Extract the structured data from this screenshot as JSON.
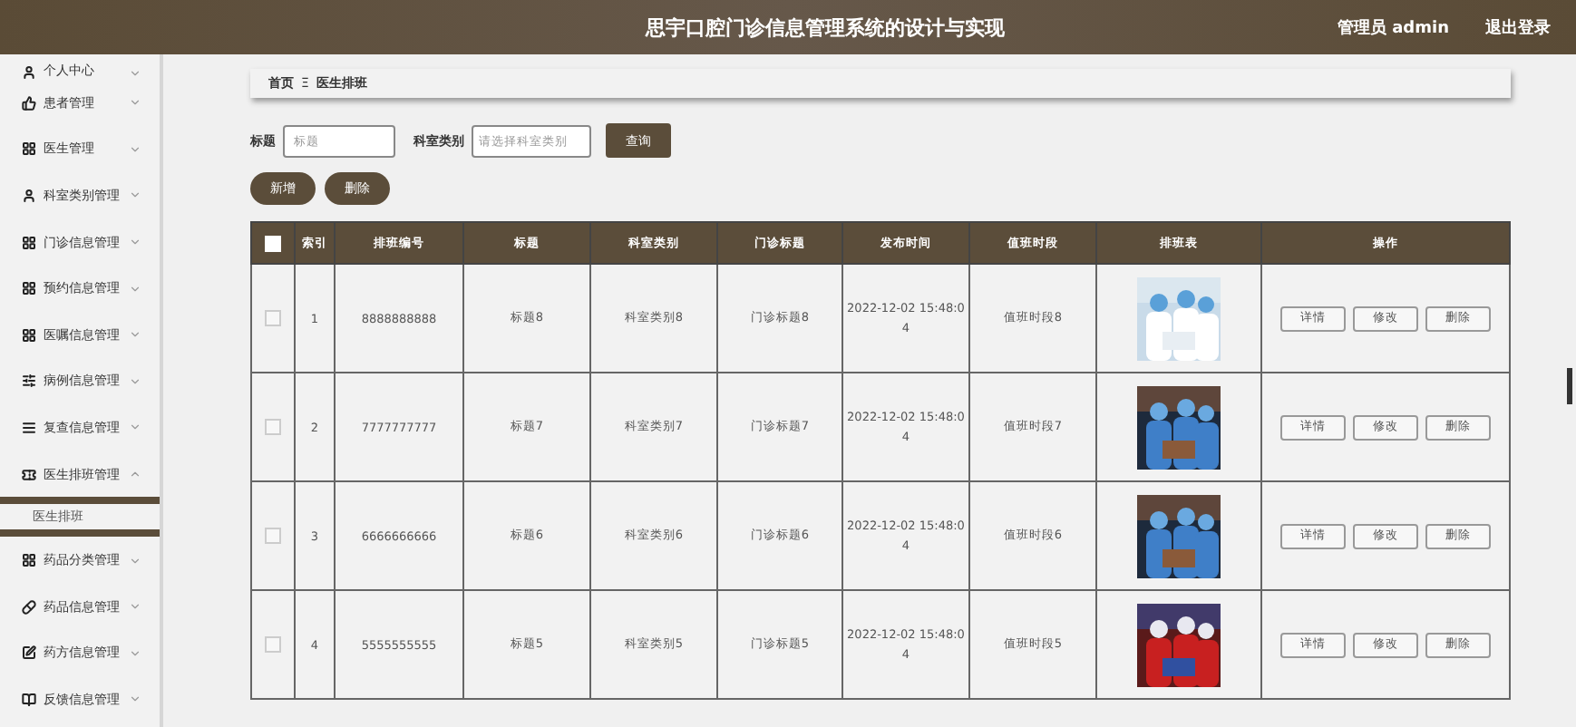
{
  "header": {
    "title": "思宇口腔门诊信息管理系统的设计与实现",
    "user": "管理员 admin",
    "logout": "退出登录"
  },
  "sidebar": {
    "items": [
      {
        "label": "个人中心",
        "expanded": false
      },
      {
        "label": "患者管理",
        "expanded": false
      },
      {
        "label": "医生管理",
        "expanded": false
      },
      {
        "label": "科室类别管理",
        "expanded": false
      },
      {
        "label": "门诊信息管理",
        "expanded": false
      },
      {
        "label": "预约信息管理",
        "expanded": false
      },
      {
        "label": "医嘱信息管理",
        "expanded": false
      },
      {
        "label": "病例信息管理",
        "expanded": false
      },
      {
        "label": "复查信息管理",
        "expanded": false
      },
      {
        "label": "医生排班管理",
        "expanded": true,
        "children": [
          {
            "label": "医生排班",
            "selected": true
          }
        ]
      },
      {
        "label": "药品分类管理",
        "expanded": false
      },
      {
        "label": "药品信息管理",
        "expanded": false
      },
      {
        "label": "药方信息管理",
        "expanded": false
      },
      {
        "label": "反馈信息管理",
        "expanded": false
      }
    ]
  },
  "breadcrumb": {
    "home": "首页",
    "separator": "Ξ",
    "current": "医生排班"
  },
  "search": {
    "title_label": "标题",
    "title_placeholder": "标题",
    "category_label": "科室类别",
    "category_placeholder": "请选择科室类别",
    "button": "查询"
  },
  "actions": [
    "新增",
    "删除"
  ],
  "table": {
    "header_checked": false,
    "columns": [
      "索引",
      "排班编号",
      "标题",
      "科室类别",
      "门诊标题",
      "发布时间",
      "值班时段",
      "排班表",
      "操作"
    ],
    "rows": [
      {
        "checked": false,
        "index": "1",
        "code": "8888888888",
        "title": "标题8",
        "category": "科室类别8",
        "clinic": "门诊标题8",
        "time": "2022-12-02 15:48:04",
        "shift": "值班时段8",
        "schedule": {
          "kind": "picture"
        },
        "buttons": [
          "详情",
          "修改",
          "删除"
        ]
      },
      {
        "checked": false,
        "index": "2",
        "code": "7777777777",
        "title": "标题7",
        "category": "科室类别7",
        "clinic": "门诊标题7",
        "time": "2022-12-02 15:48:04",
        "shift": "值班时段7",
        "schedule": {
          "kind": "picture"
        },
        "buttons": [
          "详情",
          "修改",
          "删除"
        ]
      },
      {
        "checked": false,
        "index": "3",
        "code": "6666666666",
        "title": "标题6",
        "category": "科室类别6",
        "clinic": "门诊标题6",
        "time": "2022-12-02 15:48:04",
        "shift": "值班时段6",
        "schedule": {
          "kind": "picture"
        },
        "buttons": [
          "详情",
          "修改",
          "删除"
        ]
      },
      {
        "checked": false,
        "index": "4",
        "code": "5555555555",
        "title": "标题5",
        "category": "科室类别5",
        "clinic": "门诊标题5",
        "time": "2022-12-02 15:48:04",
        "shift": "值班时段5",
        "schedule": {
          "kind": "picture"
        },
        "buttons": [
          "详情",
          "修改",
          "删除"
        ]
      }
    ]
  }
}
